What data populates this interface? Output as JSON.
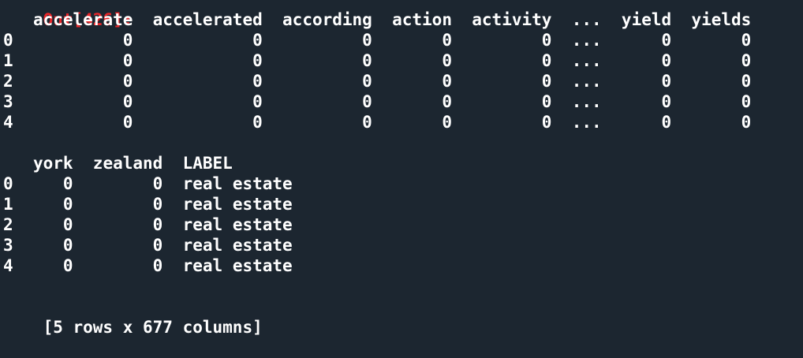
{
  "prompt": {
    "label": "Out[426]:"
  },
  "table1": {
    "columns": [
      "",
      "accelerate",
      "accelerated",
      "according",
      "action",
      "activity",
      "...",
      "yield",
      "yields"
    ],
    "rows": [
      [
        "0",
        "0",
        "0",
        "0",
        "0",
        "0",
        "...",
        "0",
        "0"
      ],
      [
        "1",
        "0",
        "0",
        "0",
        "0",
        "0",
        "...",
        "0",
        "0"
      ],
      [
        "2",
        "0",
        "0",
        "0",
        "0",
        "0",
        "...",
        "0",
        "0"
      ],
      [
        "3",
        "0",
        "0",
        "0",
        "0",
        "0",
        "...",
        "0",
        "0"
      ],
      [
        "4",
        "0",
        "0",
        "0",
        "0",
        "0",
        "...",
        "0",
        "0"
      ]
    ]
  },
  "table2": {
    "columns": [
      "",
      "york",
      "zealand",
      "LABEL"
    ],
    "rows": [
      [
        "0",
        "0",
        "0",
        "real estate"
      ],
      [
        "1",
        "0",
        "0",
        "real estate"
      ],
      [
        "2",
        "0",
        "0",
        "real estate"
      ],
      [
        "3",
        "0",
        "0",
        "real estate"
      ],
      [
        "4",
        "0",
        "0",
        "real estate"
      ]
    ]
  },
  "summary": "[5 rows x 677 columns]",
  "colors": {
    "background": "#1c2630",
    "text": "#ffffff",
    "prompt": "#e8262a"
  }
}
